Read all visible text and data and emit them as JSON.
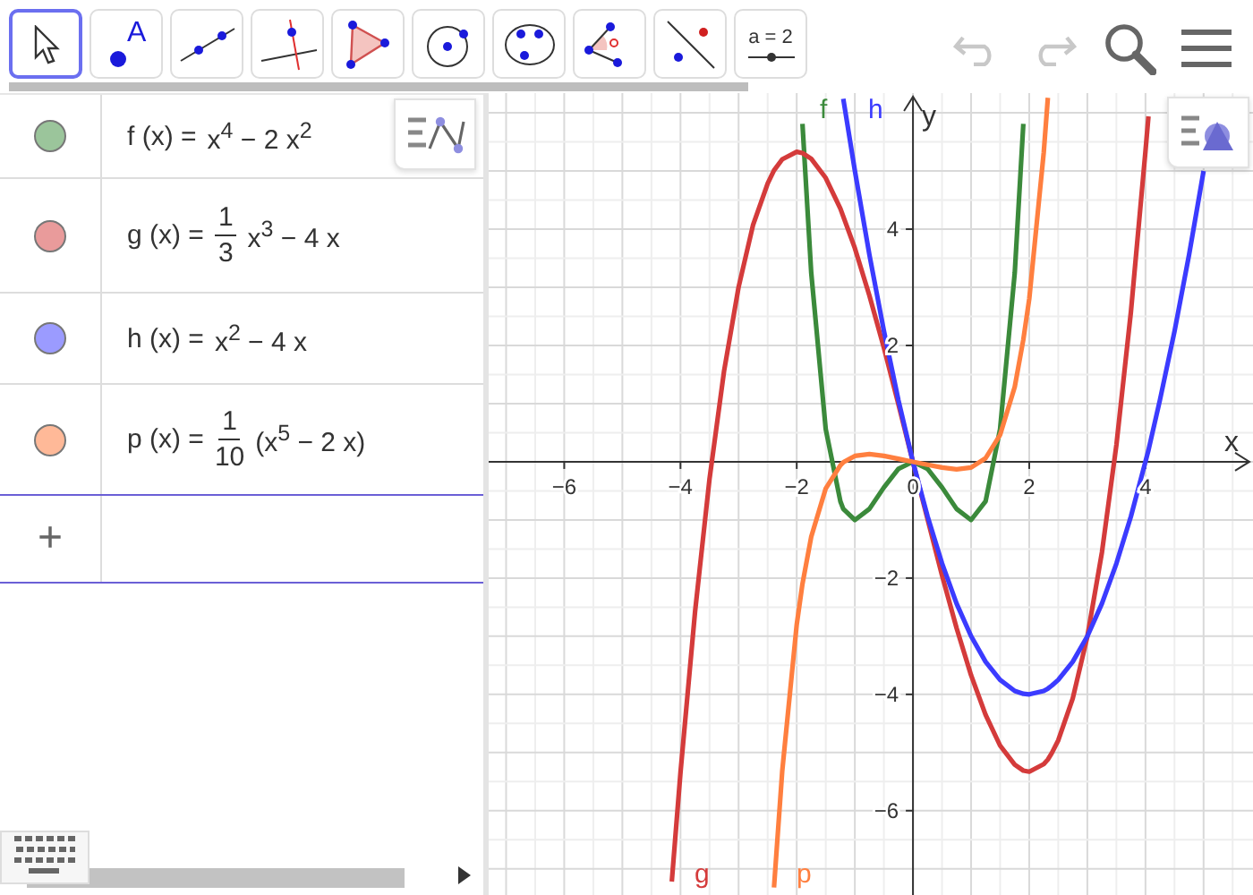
{
  "toolbar": {
    "tools": [
      {
        "kind": "move",
        "selected": true
      },
      {
        "kind": "point",
        "selected": false,
        "label": "A"
      },
      {
        "kind": "line",
        "selected": false
      },
      {
        "kind": "perpendicular",
        "selected": false
      },
      {
        "kind": "polygon",
        "selected": false
      },
      {
        "kind": "circle",
        "selected": false
      },
      {
        "kind": "conic",
        "selected": false
      },
      {
        "kind": "angle",
        "selected": false
      },
      {
        "kind": "reflect",
        "selected": false
      },
      {
        "kind": "slider",
        "selected": false,
        "label": "a = 2"
      }
    ]
  },
  "algebra": {
    "items": [
      {
        "color": "#9bc59b",
        "lhs": "f (x) =",
        "rhs": "x$^{4}$ − 2 x$^{2}$"
      },
      {
        "color": "#e99b9b",
        "lhs": "g (x) =",
        "fraction": {
          "numerator": "1",
          "denominator": "3"
        },
        "rhs": "x$^{3}$ − 4 x"
      },
      {
        "color": "#9b9bff",
        "lhs": "h (x) =",
        "rhs": "x$^{2}$ − 4 x"
      },
      {
        "color": "#ffb998",
        "lhs": "p (x) =",
        "fraction": {
          "numerator": "1",
          "denominator": "10"
        },
        "rhs": "(x$^{5}$ − 2 x)"
      }
    ],
    "input_icon": "+"
  },
  "graphics": {
    "chart_data": {
      "type": "line",
      "xlabel": "x",
      "ylabel": "y",
      "xlim": [
        -7.3,
        5.85
      ],
      "ylim": [
        -7.45,
        6.34
      ],
      "grid": true,
      "xticks": [
        {
          "value": -6,
          "label": "−6"
        },
        {
          "value": -4,
          "label": "−4"
        },
        {
          "value": -2,
          "label": "−2"
        },
        {
          "value": 0,
          "label": "0"
        },
        {
          "value": 2,
          "label": "2"
        },
        {
          "value": 4,
          "label": "4"
        }
      ],
      "yticks": [
        {
          "value": -6,
          "label": "−6"
        },
        {
          "value": -4,
          "label": "−4"
        },
        {
          "value": -2,
          "label": "−2"
        },
        {
          "value": 2,
          "label": "2"
        },
        {
          "value": 4,
          "label": "4"
        }
      ],
      "x": [
        -4.15,
        -4,
        -3.75,
        -3.5,
        -3.25,
        -3,
        -2.75,
        -2.5,
        -2.39,
        -2.25,
        -2,
        -1.9,
        -1.75,
        -1.5,
        -1.25,
        -1.2,
        -1,
        -0.75,
        -0.5,
        -0.25,
        0,
        0.25,
        0.5,
        0.75,
        1,
        1.25,
        1.5,
        1.75,
        1.9,
        2,
        2.25,
        2.32,
        2.39,
        2.5,
        2.75,
        3,
        3.25,
        3.5,
        3.75,
        4,
        4.05,
        4.25,
        4.5,
        4.75,
        5
      ],
      "series": [
        {
          "name": "f",
          "color": "#3b8a3b",
          "values": [
            null,
            null,
            null,
            null,
            null,
            null,
            null,
            null,
            null,
            null,
            null,
            5.81,
            3.25,
            0.56,
            -0.68,
            -0.81,
            -1,
            -0.81,
            -0.44,
            -0.12,
            0,
            -0.12,
            -0.44,
            -0.81,
            -1,
            -0.68,
            0.56,
            3.25,
            5.81,
            null,
            null,
            null,
            null,
            null,
            null,
            null,
            null,
            null,
            null,
            null,
            null,
            null,
            null,
            null,
            null
          ]
        },
        {
          "name": "g",
          "color": "#d43b3b",
          "values": [
            -7.22,
            -5.33,
            -2.58,
            -0.29,
            1.56,
            3,
            4.07,
            4.79,
            5.01,
            5.2,
            5.33,
            5.31,
            5.21,
            4.88,
            4.35,
            4.22,
            3.67,
            2.86,
            1.96,
            0.99,
            0,
            -0.99,
            -1.96,
            -2.86,
            -3.67,
            -4.35,
            -4.88,
            -5.21,
            -5.31,
            -5.33,
            -5.2,
            -5.12,
            -5.01,
            -4.79,
            -4.07,
            -3,
            -1.56,
            0.29,
            2.58,
            5.33,
            5.94,
            null,
            null,
            null,
            null
          ]
        },
        {
          "name": "h",
          "color": "#3b3bff",
          "values": [
            null,
            null,
            null,
            null,
            null,
            null,
            null,
            null,
            null,
            null,
            null,
            null,
            null,
            null,
            null,
            6.24,
            5,
            3.56,
            2.25,
            1.06,
            0,
            -0.94,
            -1.75,
            -2.44,
            -3,
            -3.44,
            -3.75,
            -3.94,
            -3.99,
            -4,
            -3.94,
            -3.9,
            -3.85,
            -3.75,
            -3.44,
            -3,
            -2.44,
            -1.75,
            -0.94,
            0,
            0.2,
            1.06,
            2.25,
            3.56,
            5
          ]
        },
        {
          "name": "p",
          "color": "#ff7f3f",
          "values": [
            null,
            null,
            null,
            null,
            null,
            null,
            null,
            null,
            -7.32,
            -5.32,
            -2.8,
            -2.1,
            -1.29,
            -0.46,
            -0.06,
            -0.01,
            0.1,
            0.13,
            0.1,
            0.05,
            0,
            -0.05,
            -0.1,
            -0.13,
            -0.1,
            0.06,
            0.46,
            1.29,
            2.1,
            2.8,
            5.32,
            6.26,
            null,
            null,
            null,
            null,
            null,
            null,
            null,
            null,
            null,
            null,
            null,
            null,
            null
          ]
        }
      ]
    }
  }
}
